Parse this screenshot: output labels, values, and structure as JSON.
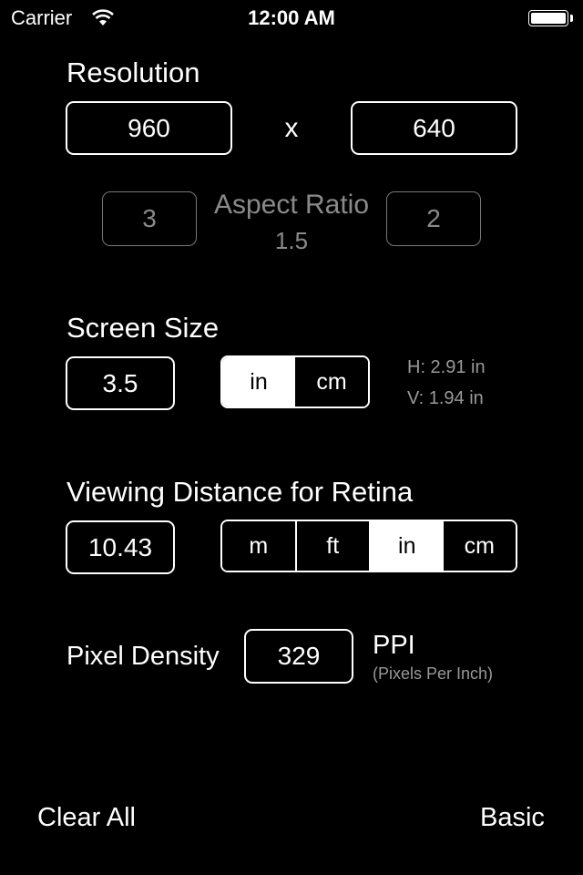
{
  "status_bar": {
    "carrier": "Carrier",
    "time": "12:00 AM"
  },
  "resolution": {
    "title": "Resolution",
    "width_value": "960",
    "separator": "x",
    "height_value": "640"
  },
  "aspect_ratio": {
    "label": "Aspect Ratio",
    "left_value": "3",
    "right_value": "2",
    "ratio": "1.5"
  },
  "screen_size": {
    "title": "Screen Size",
    "value": "3.5",
    "units": [
      {
        "label": "in",
        "selected": true
      },
      {
        "label": "cm",
        "selected": false
      }
    ],
    "horizontal": "H: 2.91 in",
    "vertical": "V: 1.94 in"
  },
  "viewing_distance": {
    "title": "Viewing Distance for Retina",
    "value": "10.43",
    "units": [
      {
        "label": "m",
        "selected": false
      },
      {
        "label": "ft",
        "selected": false
      },
      {
        "label": "in",
        "selected": true
      },
      {
        "label": "cm",
        "selected": false
      }
    ]
  },
  "pixel_density": {
    "title": "Pixel Density",
    "value": "329",
    "unit": "PPI",
    "unit_description": "(Pixels Per Inch)"
  },
  "footer": {
    "clear_all": "Clear All",
    "mode": "Basic"
  }
}
